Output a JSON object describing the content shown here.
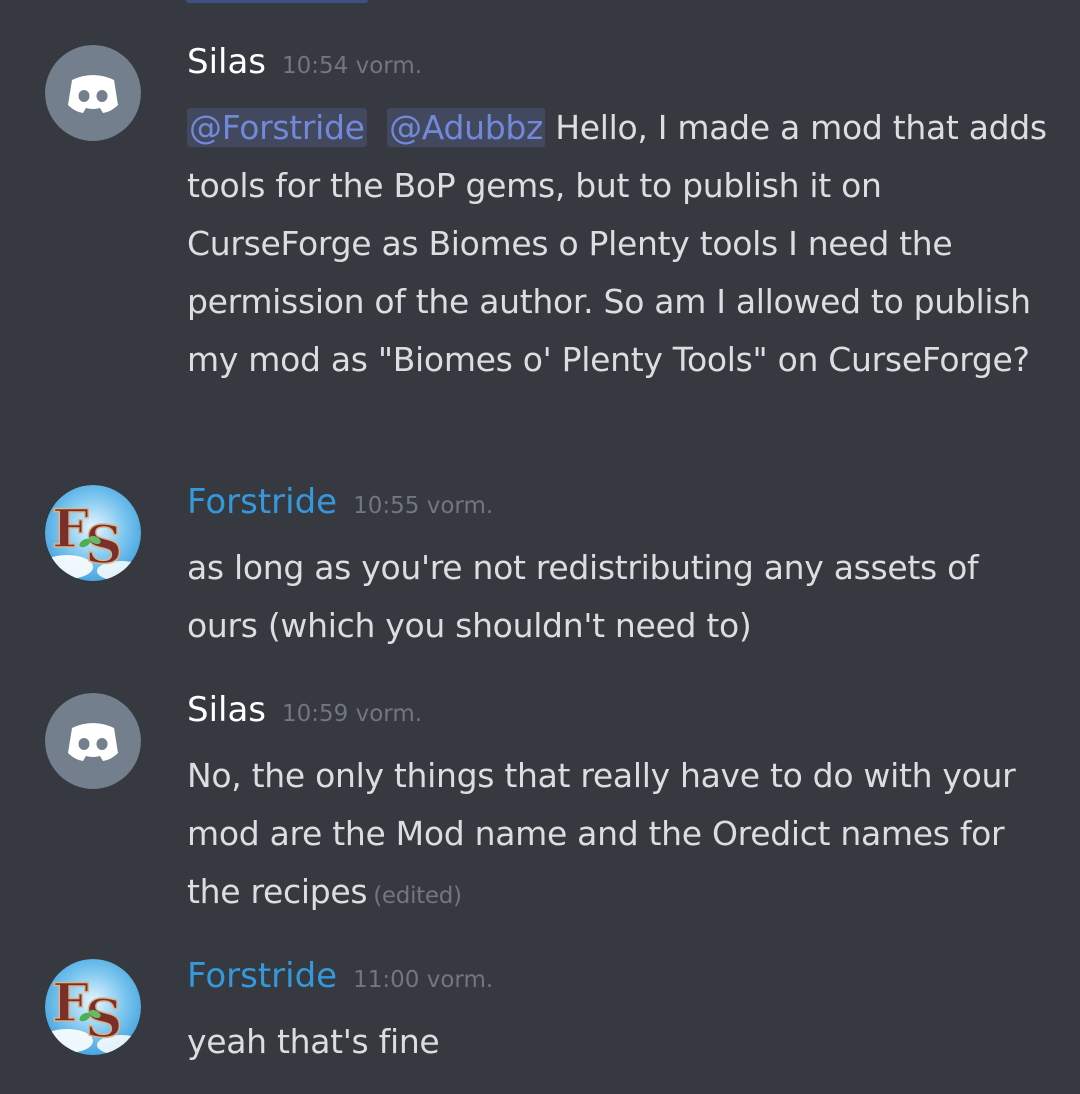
{
  "colors": {
    "background": "#36393f",
    "text": "#dcddde",
    "username_default": "#ffffff",
    "username_role": "#3498db",
    "timestamp": "#72767d",
    "mention_text": "#7289da",
    "discord_avatar_bg": "#747f8d"
  },
  "messages": [
    {
      "author": "Silas",
      "avatar": "discord-default-avatar",
      "timestamp": "10:54 vorm.",
      "mention_1": "@Forstride",
      "mention_2": "@Adubbz",
      "text": " Hello, I made a mod that adds tools for the BoP gems, but to publish it on CurseForge as Biomes o Plenty tools I need the permission of the author. So am I allowed to publish my mod as \"Biomes o' Plenty Tools\" on CurseForge?"
    },
    {
      "author": "Forstride",
      "avatar": "forstride-fs-avatar",
      "timestamp": "10:55 vorm.",
      "text": "as long as you're not redistributing any assets of ours (which you shouldn't need to)"
    },
    {
      "author": "Silas",
      "avatar": "discord-default-avatar",
      "timestamp": "10:59 vorm.",
      "text": "No, the only things that really have to do with your mod are the Mod name and the Oredict names for the recipes",
      "edited_label": "(edited)"
    },
    {
      "author": "Forstride",
      "avatar": "forstride-fs-avatar",
      "timestamp": "11:00 vorm.",
      "text": "yeah that's fine"
    }
  ]
}
